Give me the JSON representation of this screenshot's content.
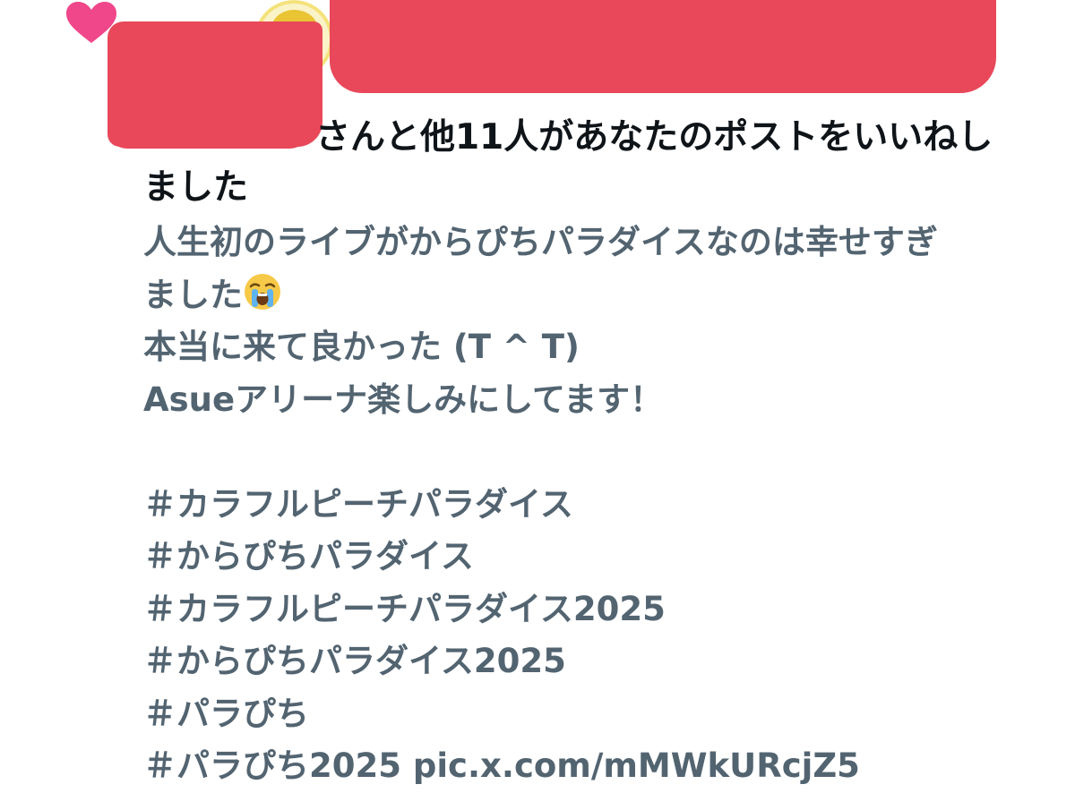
{
  "notification": {
    "text_after_name": "さんと他11人があなたのポストをいいねし",
    "text_wrap": "ました",
    "icon": "heart-icon",
    "accent": "#f0468a",
    "redaction_color": "#e8485a"
  },
  "post": {
    "line1": "人生初のライブがからぴちパラダイスなのは幸せすぎ",
    "line2": "ました",
    "emoji": "loudly-crying-face-icon",
    "line3": "本当に来て良かった (T ^ T)",
    "line4": "Asueアリーナ楽しみにしてます！",
    "hashtags": [
      "＃カラフルピーチパラダイス",
      "＃からぴちパラダイス",
      "＃カラフルピーチパラダイス2025",
      "＃からぴちパラダイス2025",
      "＃パラぴち",
      "＃パラぴち2025"
    ],
    "link": "pic.x.com/mMWkURcjZ5",
    "text_color": "#536471"
  }
}
